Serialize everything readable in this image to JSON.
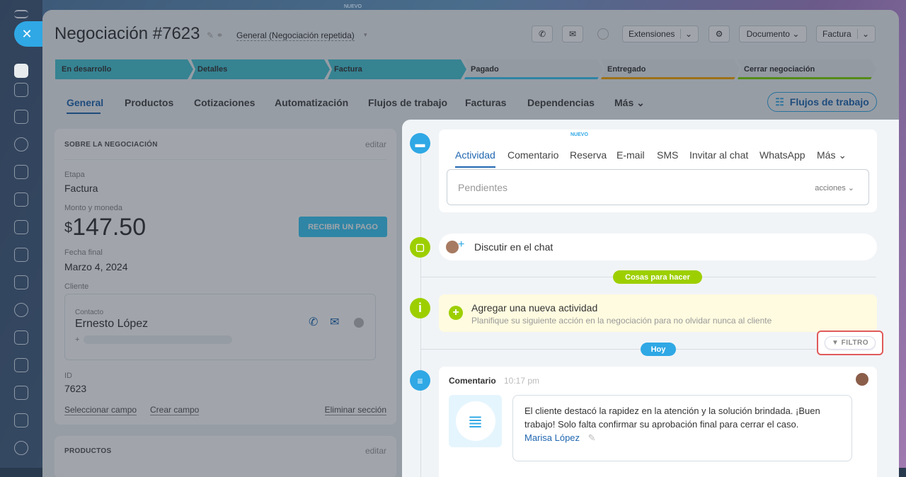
{
  "sidebar": {
    "close_label": "✕",
    "top_label": "NUEVO"
  },
  "header": {
    "title": "Negociación #7623",
    "category": "General (Negociación repetida)",
    "extensions": "Extensiones",
    "document": "Documento",
    "invoice": "Factura"
  },
  "stages": [
    {
      "label": "En desarrollo",
      "color": "#47c4d4"
    },
    {
      "label": "Detalles",
      "color": "#47c4d4"
    },
    {
      "label": "Factura",
      "color": "#47c4d4"
    },
    {
      "label": "Pagado",
      "color": "#e8ecef"
    },
    {
      "label": "Entregado",
      "color": "#e8ecef"
    },
    {
      "label": "Cerrar negociación",
      "color": "#e8ecef"
    }
  ],
  "tabs": [
    "General",
    "Productos",
    "Cotizaciones",
    "Automatización",
    "Flujos de trabajo",
    "Facturas",
    "Dependencias",
    "Más"
  ],
  "flows_button": "Flujos de trabajo",
  "deal": {
    "section_title": "SOBRE LA NEGOCIACIÓN",
    "edit": "editar",
    "stage_label": "Etapa",
    "stage_value": "Factura",
    "amount_label": "Monto y moneda",
    "currency": "$",
    "amount": "147.50",
    "pay_button": "RECIBIR UN PAGO",
    "date_label": "Fecha final",
    "date_value": "Marzo 4, 2024",
    "client_label": "Cliente",
    "contact_label": "Contacto",
    "contact_name": "Ernesto López",
    "contact_phone": "+",
    "id_label": "ID",
    "id_value": "7623",
    "select_field": "Seleccionar campo",
    "create_field": "Crear campo",
    "delete_section": "Eliminar sección"
  },
  "products": {
    "title": "PRODUCTOS",
    "edit": "editar"
  },
  "activity": {
    "tabs": [
      "Actividad",
      "Comentario",
      "Reserva",
      "E-mail",
      "SMS",
      "Invitar al chat",
      "WhatsApp",
      "Más"
    ],
    "new_badge": "NUEVO",
    "pending_placeholder": "Pendientes",
    "actions": "acciones",
    "chat": "Discutir en el chat",
    "todo_pill": "Cosas para hacer",
    "add_title": "Agregar una nueva actividad",
    "add_desc": "Planifique su siguiente acción en la negociación para no olvidar nunca al cliente",
    "today_pill": "Hoy",
    "filter": "FILTRO",
    "comment_title": "Comentario",
    "comment_time": "10:17 pm",
    "comment_text": "El cliente destacó la rapidez en la atención y la solución brindada. ¡Buen trabajo! Solo falta confirmar su aprobación final para cerrar el caso.",
    "comment_author": "Marisa López"
  }
}
